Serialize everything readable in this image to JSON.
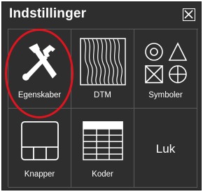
{
  "window": {
    "title": "Indstillinger"
  },
  "tiles": [
    {
      "label": "Egenskaber",
      "icon": "tools-icon"
    },
    {
      "label": "DTM",
      "icon": "dtm-icon"
    },
    {
      "label": "Symboler",
      "icon": "symbols-icon"
    },
    {
      "label": "Knapper",
      "icon": "buttons-layout-icon"
    },
    {
      "label": "Koder",
      "icon": "codes-table-icon"
    },
    {
      "label": "Luk",
      "icon": ""
    }
  ],
  "colors": {
    "background": "#2e2e2e",
    "grid_line": "#5a5a5a",
    "highlight": "#e0141e"
  }
}
